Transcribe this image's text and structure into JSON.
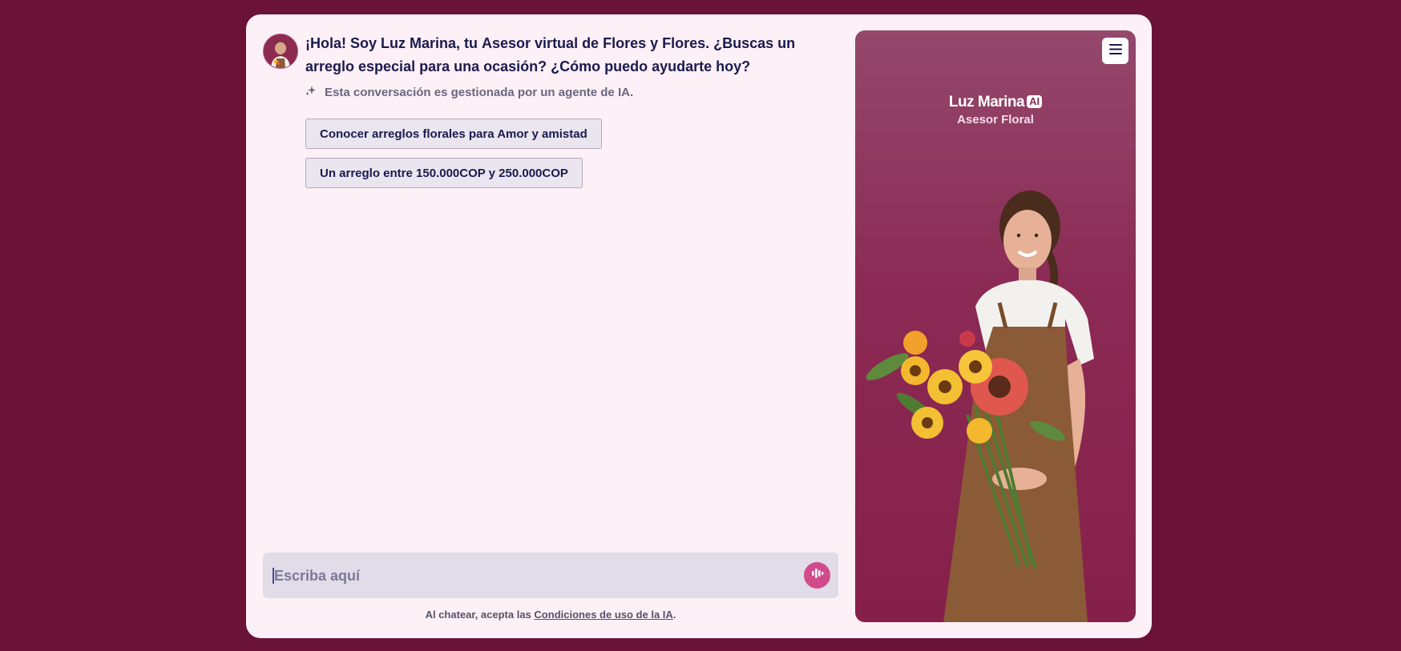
{
  "chat": {
    "greeting_pre": "¡Hola! Soy Luz Marina, tu ",
    "greeting_bold": "Asesor virtual de Flores y Flores",
    "greeting_post": ". ¿Buscas un arreglo especial para una ocasión? ¿Cómo puedo ayudarte hoy?",
    "ai_note": "Esta conversación es gestionada por un agente de IA.",
    "suggestions": [
      "Conocer arreglos florales para Amor y amistad",
      "Un arreglo entre 150.000COP y 250.000COP"
    ],
    "input_placeholder": "Escriba aquí",
    "legal_pre": "Al chatear, acepta las ",
    "legal_link": "Condiciones de uso de la IA",
    "legal_post": "."
  },
  "panel": {
    "name": "Luz Marina",
    "badge": "AI",
    "role": "Asesor Floral"
  },
  "icons": {
    "sparkle": "sparkle-icon",
    "mic": "voice-icon",
    "menu": "hamburger-menu-icon"
  },
  "colors": {
    "background": "#6b1238",
    "card": "#fdf0f6",
    "accent": "#d14b8b",
    "text": "#1a1a4e"
  }
}
